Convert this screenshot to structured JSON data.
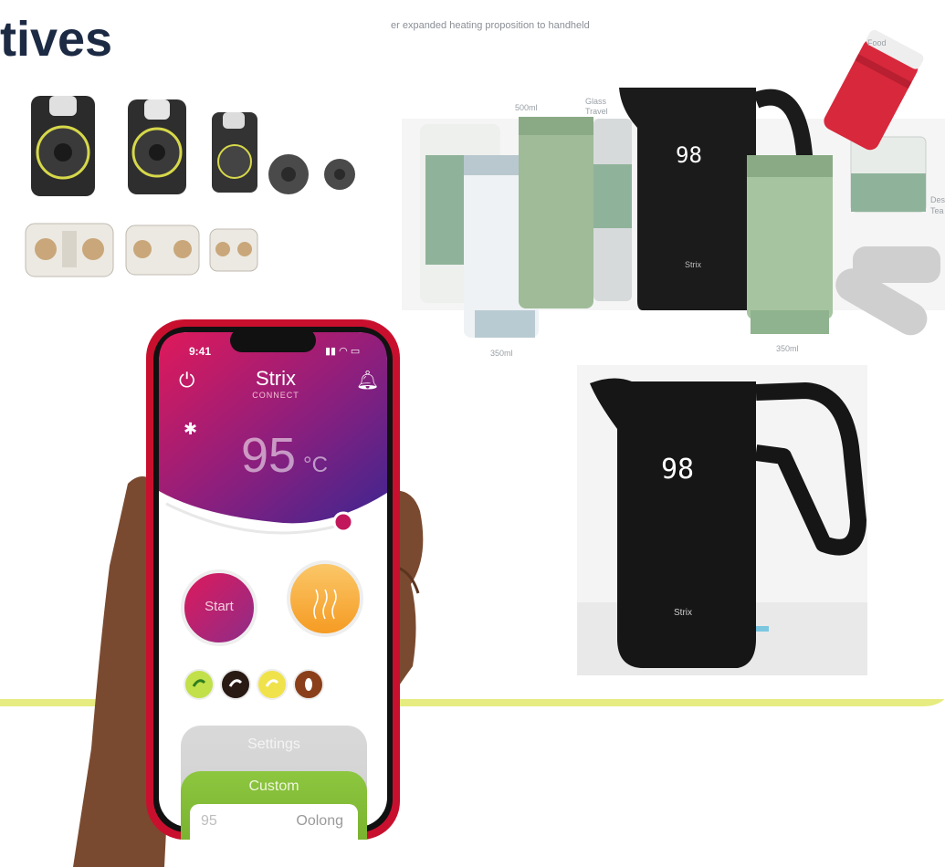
{
  "slide": {
    "title": "tives"
  },
  "family_photo": {
    "caption": "er expanded heating proposition to handheld",
    "labels": {
      "food": "Food",
      "ml500": "500ml",
      "glass_travel_1": "Glass",
      "glass_travel_2": "Travel",
      "des_1": "Des",
      "des_2": "Tea",
      "ml350_left": "350ml",
      "ml350_right": "350ml"
    },
    "display_value": "98",
    "kettle_brand": "Strix"
  },
  "kettle_photo": {
    "display_value": "98",
    "brand": "Strix"
  },
  "phone": {
    "status_time": "9:41",
    "app_name": "Strix",
    "app_sub": "CONNECT",
    "temperature": "95",
    "temperature_unit": "°C",
    "start_label": "Start",
    "settings_label": "Settings",
    "custom_label": "Custom",
    "custom_temp": "95",
    "custom_tea": "Oolong"
  },
  "colors": {
    "title": "#1d2a44",
    "accent_yellow": "#e6ec7f",
    "gradient_pink": "#e0195a",
    "gradient_purple": "#3d2690",
    "orange": "#f7a72b",
    "green": "#8dc63f"
  }
}
